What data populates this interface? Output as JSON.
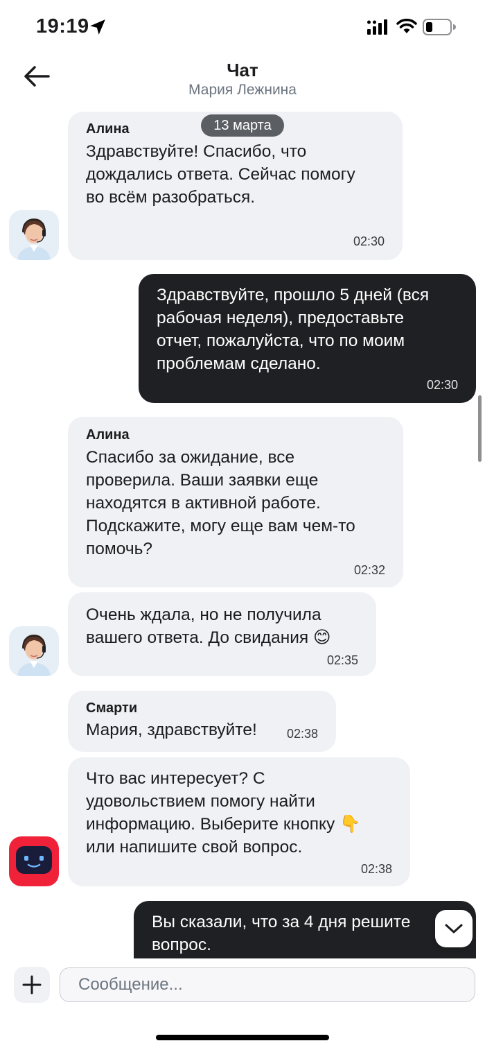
{
  "status_bar": {
    "time": "19:19"
  },
  "header": {
    "title": "Чат",
    "subtitle": "Мария Лежнина"
  },
  "chat": {
    "date_pill": "13 марта",
    "messages": [
      {
        "sender": "Алина",
        "text": "Здравствуйте! Спасибо, что\nдождались ответа. Сейчас помогу\nво всём разобраться.",
        "time": "02:30"
      },
      {
        "text": "Здравствуйте, прошло 5 дней (вся\nрабочая неделя), предоставьте\nотчет, пожалуйста, что по моим\nпроблемам сделано.",
        "time": "02:30"
      },
      {
        "sender": "Алина",
        "text": "Спасибо за ожидание, все\nпроверила. Ваши заявки еще\nнаходятся в активной работе.\nПодскажите, могу еще вам чем-то\nпомочь?",
        "time": "02:32"
      },
      {
        "text": "Очень ждала, но не получила\nвашего ответа. До свидания 😊",
        "time": "02:35"
      },
      {
        "sender": "Смарти",
        "text": "Мария, здравствуйте!",
        "time": "02:38"
      },
      {
        "text": "Что вас интересует? С\nудовольствием помогу найти\nинформацию. Выберите кнопку 👇\nили напишите свой вопрос.",
        "time": "02:38"
      },
      {
        "text": "Вы сказали, что за 4 дня решите\nвопрос."
      }
    ]
  },
  "input": {
    "placeholder": "Сообщение..."
  },
  "icons": {
    "back": "arrow-left-icon",
    "scroll_down": "chevron-down-icon",
    "add": "plus-icon"
  },
  "colors": {
    "incoming": "#f0f1f5",
    "outgoing": "#1e2023",
    "bot_avatar": "#f0223a"
  }
}
